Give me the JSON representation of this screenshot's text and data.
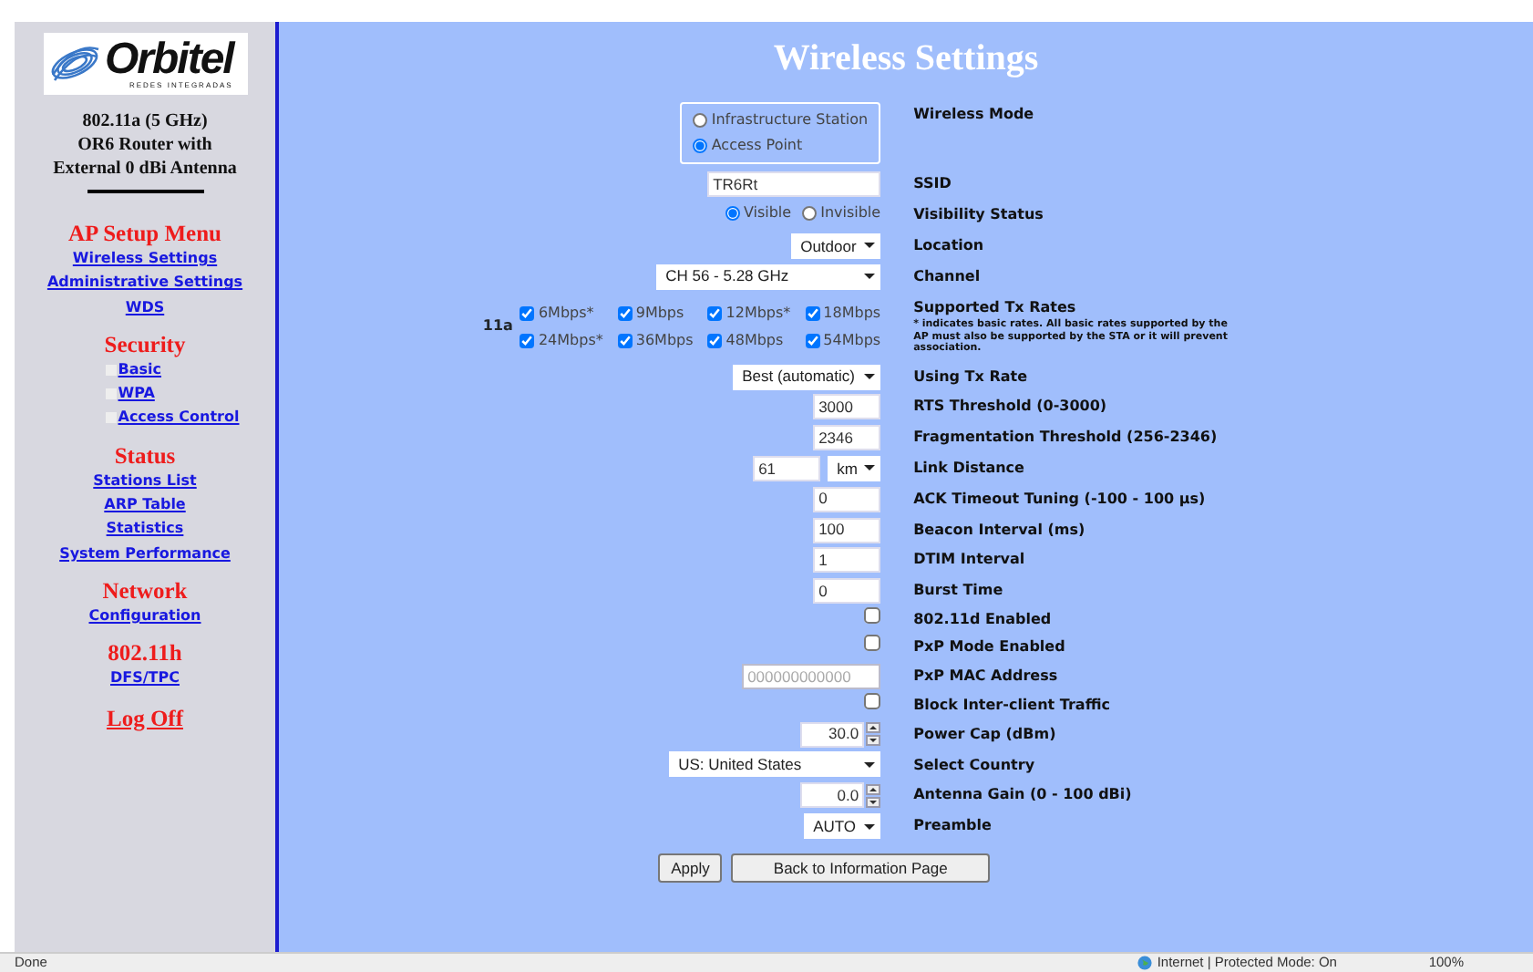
{
  "sidebar": {
    "logo": {
      "name": "Orbitel",
      "tagline": "REDES INTEGRADAS"
    },
    "device_info": [
      "802.11a (5 GHz)",
      "OR6 Router with",
      "External 0 dBi Antenna"
    ],
    "sections": [
      {
        "heading": "AP Setup Menu",
        "links": [
          {
            "label": "Wireless Settings",
            "bullet": false
          },
          {
            "label": "Administrative Settings",
            "bullet": false
          },
          {
            "label": "WDS",
            "bullet": false
          }
        ]
      },
      {
        "heading": "Security",
        "links": [
          {
            "label": "Basic",
            "bullet": true
          },
          {
            "label": "WPA",
            "bullet": true
          },
          {
            "label": "Access Control",
            "bullet": true
          }
        ]
      },
      {
        "heading": "Status",
        "links": [
          {
            "label": "Stations List",
            "bullet": false
          },
          {
            "label": "ARP Table",
            "bullet": false
          },
          {
            "label": "Statistics",
            "bullet": false
          },
          {
            "label": "System Performance",
            "bullet": false
          }
        ]
      },
      {
        "heading": "Network",
        "links": [
          {
            "label": "Configuration",
            "bullet": false
          }
        ]
      },
      {
        "heading": "802.11h",
        "links": [
          {
            "label": "DFS/TPC",
            "bullet": false
          }
        ]
      }
    ],
    "log_off": "Log Off"
  },
  "title": "Wireless Settings",
  "settings": [
    {
      "kind": "radio-box",
      "label": "Wireless Mode",
      "options": [
        {
          "label": "Infrastructure Station",
          "selected": false
        },
        {
          "label": "Access Point",
          "selected": true
        }
      ]
    },
    {
      "kind": "text",
      "label": "SSID",
      "value": "TR6Rt"
    },
    {
      "kind": "radio-inline",
      "label": "Visibility Status",
      "options": [
        {
          "label": "Visible",
          "selected": true
        },
        {
          "label": "Invisible",
          "selected": false
        }
      ]
    },
    {
      "kind": "select",
      "label": "Location",
      "value": "Outdoor"
    },
    {
      "kind": "select",
      "label": "Channel",
      "value": "CH 56 - 5.28 GHz"
    },
    {
      "kind": "rates",
      "label": "Supported Tx Rates",
      "prefix": "11a",
      "note": "* indicates basic rates. All basic rates supported by the AP must also be supported by the STA or it will prevent association.",
      "rates": [
        {
          "label": "6Mbps*",
          "checked": true
        },
        {
          "label": "9Mbps",
          "checked": true
        },
        {
          "label": "12Mbps*",
          "checked": true
        },
        {
          "label": "18Mbps",
          "checked": true
        },
        {
          "label": "24Mbps*",
          "checked": true
        },
        {
          "label": "36Mbps",
          "checked": true
        },
        {
          "label": "48Mbps",
          "checked": true
        },
        {
          "label": "54Mbps",
          "checked": true
        }
      ]
    },
    {
      "kind": "select",
      "label": "Using Tx Rate",
      "value": "Best (automatic)"
    },
    {
      "kind": "text",
      "label": "RTS Threshold (0-3000)",
      "value": "3000"
    },
    {
      "kind": "text",
      "label": "Fragmentation Threshold (256-2346)",
      "value": "2346"
    },
    {
      "kind": "distance",
      "label": "Link Distance",
      "value": "61",
      "unit": "km"
    },
    {
      "kind": "text",
      "label": "ACK Timeout Tuning (-100 - 100 µs)",
      "value": "0"
    },
    {
      "kind": "text",
      "label": "Beacon Interval (ms)",
      "value": "100"
    },
    {
      "kind": "text",
      "label": "DTIM Interval",
      "value": "1"
    },
    {
      "kind": "text",
      "label": "Burst Time",
      "value": "0"
    },
    {
      "kind": "checkbox",
      "label": "802.11d Enabled",
      "checked": false
    },
    {
      "kind": "checkbox",
      "label": "PxP Mode Enabled",
      "checked": false
    },
    {
      "kind": "text",
      "label": "PxP MAC Address",
      "value": "000000000000",
      "disabled": true
    },
    {
      "kind": "checkbox",
      "label": "Block Inter-client Traffic",
      "checked": false
    },
    {
      "kind": "spin",
      "label": "Power Cap (dBm)",
      "value": "30.0"
    },
    {
      "kind": "select",
      "label": "Select Country",
      "value": "US: United States"
    },
    {
      "kind": "spin",
      "label": "Antenna Gain (0 - 100 dBi)",
      "value": "0.0"
    },
    {
      "kind": "select",
      "label": "Preamble",
      "value": "AUTO"
    }
  ],
  "buttons": [
    "Apply",
    "Back to Information Page"
  ],
  "status_bar": {
    "status": "Done",
    "zone": "Internet | Protected Mode: On",
    "zoom": "100%"
  }
}
